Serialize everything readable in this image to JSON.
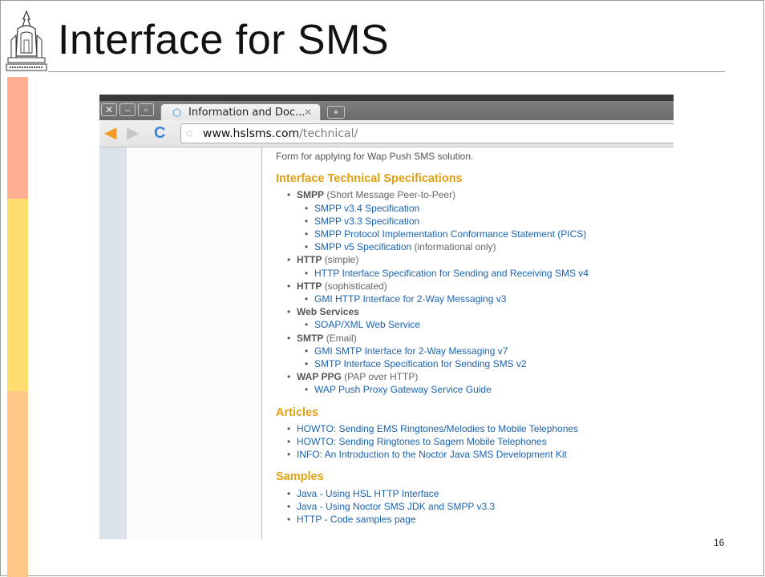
{
  "slide": {
    "title": "Interface for SMS",
    "page_number": "16",
    "left_bar_colors": [
      "#ffae8f",
      "#ffdd6e",
      "#ffc985"
    ]
  },
  "browser": {
    "tab_title": "Information and Doc...",
    "url_host": "www.hslsms.com",
    "url_path": "/technical/"
  },
  "page": {
    "intro": "Form for applying for Wap Push SMS solution.",
    "sections": {
      "specs": {
        "heading": "Interface Technical Specifications",
        "smpp": {
          "name": "SMPP",
          "desc": "(Short Message Peer-to-Peer)",
          "links": [
            "SMPP v3.4 Specification",
            "SMPP v3.3 Specification",
            "SMPP Protocol Implementation Conformance Statement (PICS)",
            "SMPP v5 Specification"
          ],
          "v5_note": "(informational only)"
        },
        "http_simple": {
          "name": "HTTP",
          "desc": "(simple)",
          "link": "HTTP Interface Specification for Sending and Receiving SMS v4"
        },
        "http_soph": {
          "name": "HTTP",
          "desc": "(sophisticated)",
          "link": "GMI HTTP Interface for 2-Way Messaging v3"
        },
        "web_services": {
          "name": "Web Services",
          "link": "SOAP/XML Web Service"
        },
        "smtp": {
          "name": "SMTP",
          "desc": "(Email)",
          "links": [
            "GMI SMTP Interface for 2-Way Messaging v7",
            "SMTP Interface Specification for Sending SMS v2"
          ]
        },
        "wap_ppg": {
          "name": "WAP PPG",
          "desc": "(PAP over HTTP)",
          "link": "WAP Push Proxy Gateway Service Guide"
        }
      },
      "articles": {
        "heading": "Articles",
        "links": [
          "HOWTO: Sending EMS Ringtones/Melodies to Mobile Telephones",
          "HOWTO: Sending Ringtones to Sagem Mobile Telephones",
          "INFO: An Introduction to the Noctor Java SMS Development Kit"
        ]
      },
      "samples": {
        "heading": "Samples",
        "links": [
          "Java - Using HSL HTTP Interface",
          "Java - Using Noctor SMS JDK and SMPP v3.3",
          "HTTP - Code samples page"
        ]
      }
    }
  }
}
